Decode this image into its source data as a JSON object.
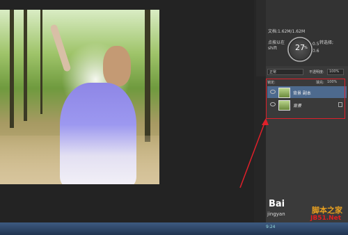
{
  "info_panel": {
    "doc_size": "文档:1.62M/1.62M",
    "line1": "点按以在",
    "line2": "shift",
    "line3": "转选择;",
    "line4": "0.5",
    "line5": "0.6",
    "gauge_value": "27",
    "gauge_unit": "%"
  },
  "layers": {
    "blend_mode": "正常",
    "opacity_label": "不透明度:",
    "opacity_value": "100%",
    "lock_label": "锁定:",
    "fill_label": "填充:",
    "fill_value": "100%",
    "items": [
      {
        "name": "背景 副本"
      },
      {
        "name": "背景"
      }
    ]
  },
  "watermark": {
    "main": "Bai",
    "sub": "jingyan",
    "jb": "脚本之家",
    "jb_url": "JB51.Net"
  },
  "taskbar": {
    "time": "9:24"
  }
}
